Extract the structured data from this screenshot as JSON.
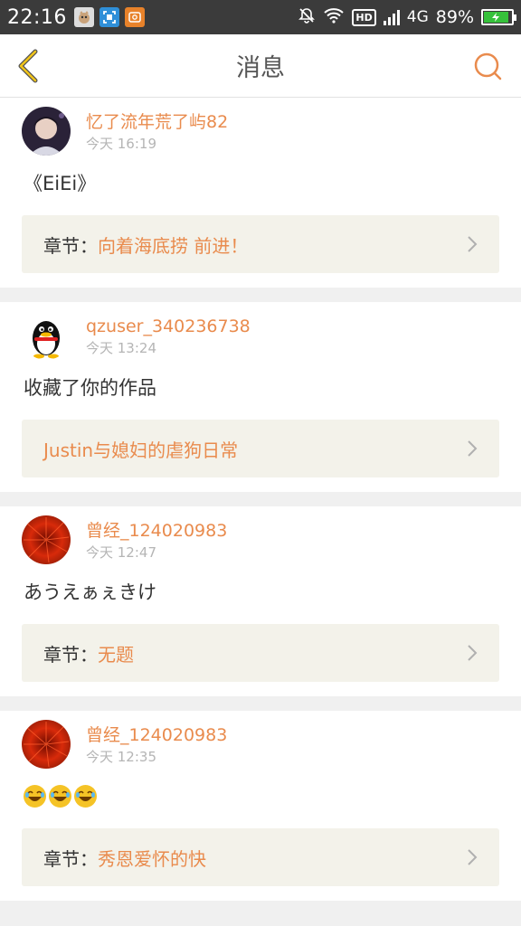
{
  "status_bar": {
    "time": "22:16",
    "network": "4G",
    "hd_label": "HD",
    "battery_percent": "89%",
    "battery_level": 0.89
  },
  "header": {
    "title": "消息"
  },
  "messages": [
    {
      "username": "忆了流年荒了屿82",
      "time": "今天 16:19",
      "content": "《EiEi》",
      "ref_prefix": "章节：",
      "ref_title": "向着海底捞 前进！"
    },
    {
      "username": "qzuser_340236738",
      "time": "今天 13:24",
      "content": "收藏了你的作品",
      "ref_prefix": "",
      "ref_title": "Justin与媳妇的虐狗日常"
    },
    {
      "username": "曾经_124020983",
      "time": "今天 12:47",
      "content": "あうえぁぇきけ",
      "ref_prefix": "章节：",
      "ref_title": "无题"
    },
    {
      "username": "曾经_124020983",
      "time": "今天 12:35",
      "content": "",
      "ref_prefix": "章节：",
      "ref_title": "秀恩爱怀的快"
    }
  ],
  "colors": {
    "accent": "#e98b4d",
    "status_bar": "#3b3b3b",
    "ref_background": "#f3f2ea"
  }
}
